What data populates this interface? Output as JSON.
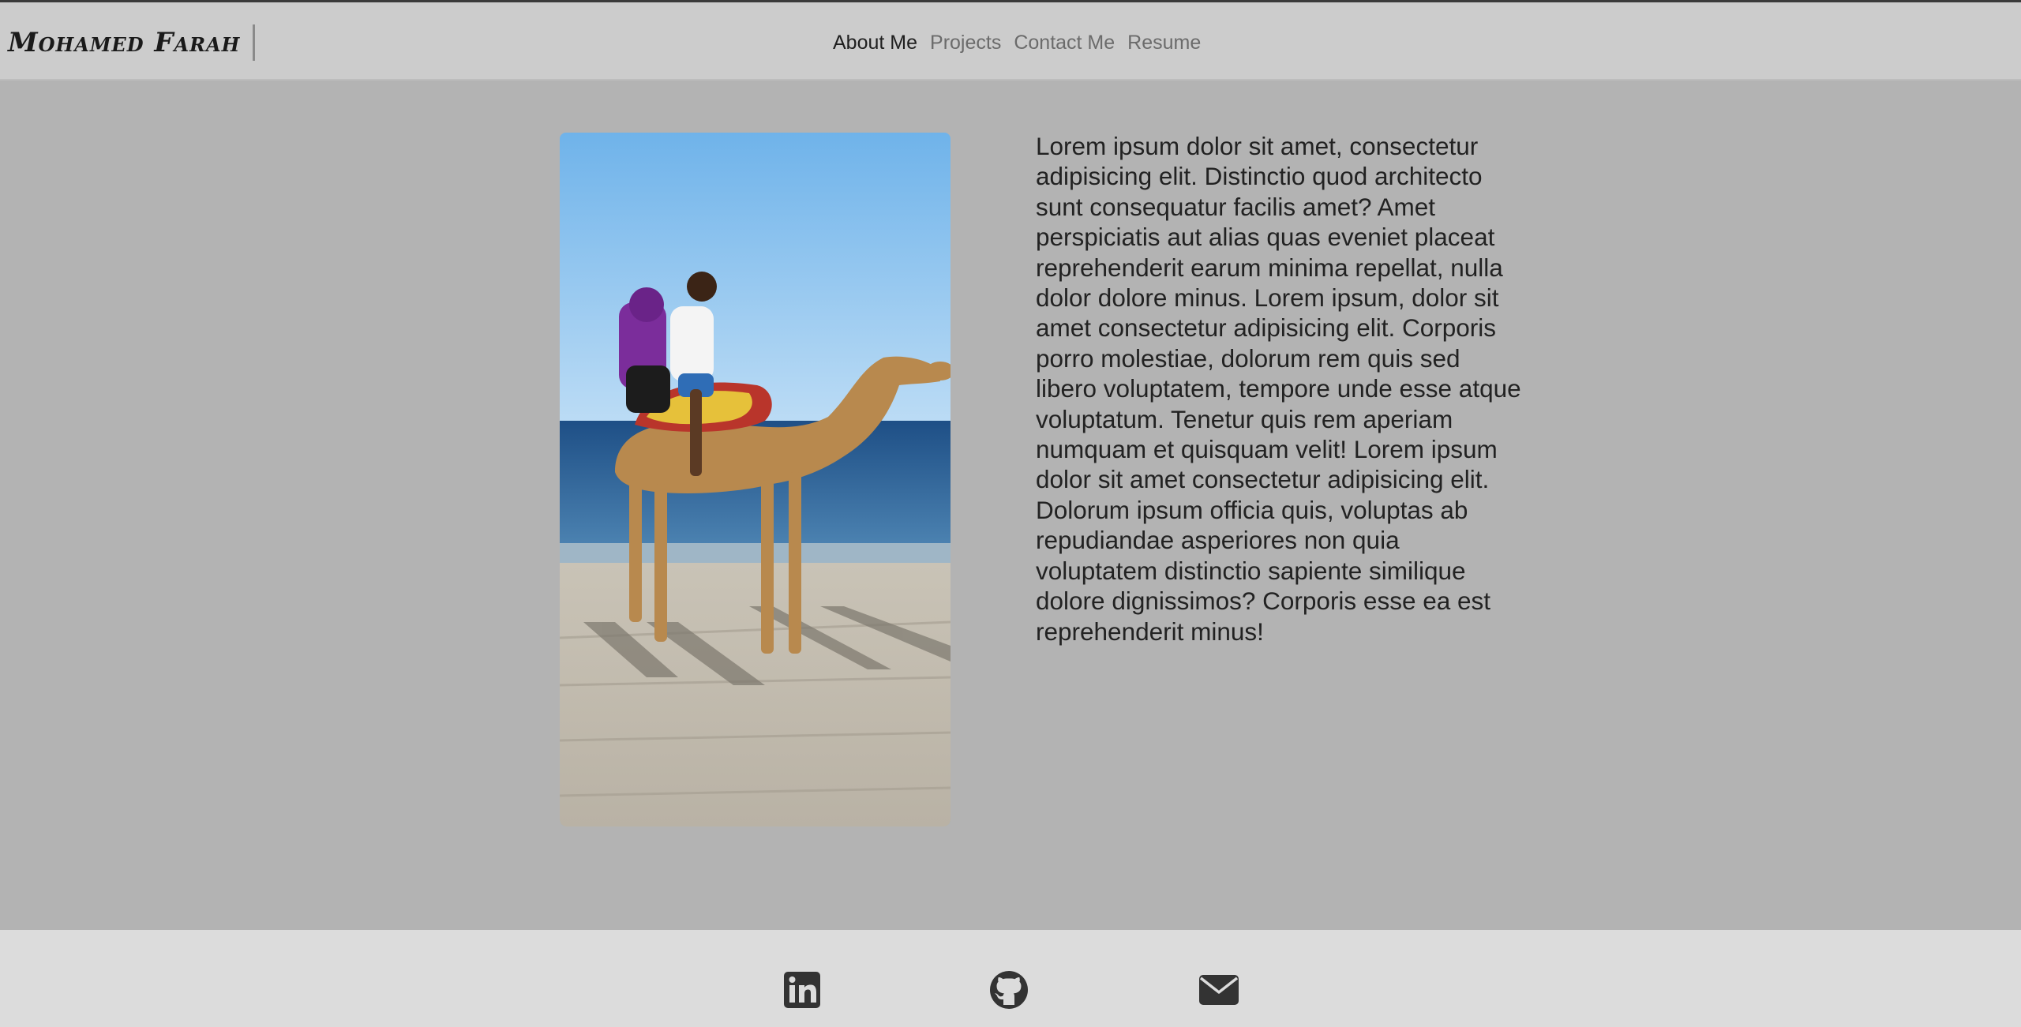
{
  "brand": {
    "name": "Mohamed Farah"
  },
  "nav": {
    "items": [
      {
        "label": "About Me",
        "active": true
      },
      {
        "label": "Projects",
        "active": false
      },
      {
        "label": "Contact Me",
        "active": false
      },
      {
        "label": "Resume",
        "active": false
      }
    ]
  },
  "about": {
    "photo_icon": "photo-camel-beach",
    "bio": "Lorem ipsum dolor sit amet, consectetur adipisicing elit. Distinctio quod architecto sunt consequatur facilis amet? Amet perspiciatis aut alias quas eveniet placeat reprehenderit earum minima repellat, nulla dolor dolore minus. Lorem ipsum, dolor sit amet consectetur adipisicing elit. Corporis porro molestiae, dolorum rem quis sed libero voluptatem, tempore unde esse atque voluptatum. Tenetur quis rem aperiam numquam et quisquam velit! Lorem ipsum dolor sit amet consectetur adipisicing elit. Dolorum ipsum officia quis, voluptas ab repudiandae asperiores non quia voluptatem distinctio sapiente similique dolore dignissimos? Corporis esse ea est reprehenderit minus!"
  },
  "footer": {
    "links": [
      {
        "icon": "linkedin-icon"
      },
      {
        "icon": "github-icon"
      },
      {
        "icon": "envelope-icon"
      }
    ]
  },
  "colors": {
    "page_bg": "#b3b3b3",
    "navbar_bg": "#cccccc",
    "footer_bg": "#dcdcdc",
    "text": "#222222",
    "nav_inactive": "#6b6b6b"
  }
}
